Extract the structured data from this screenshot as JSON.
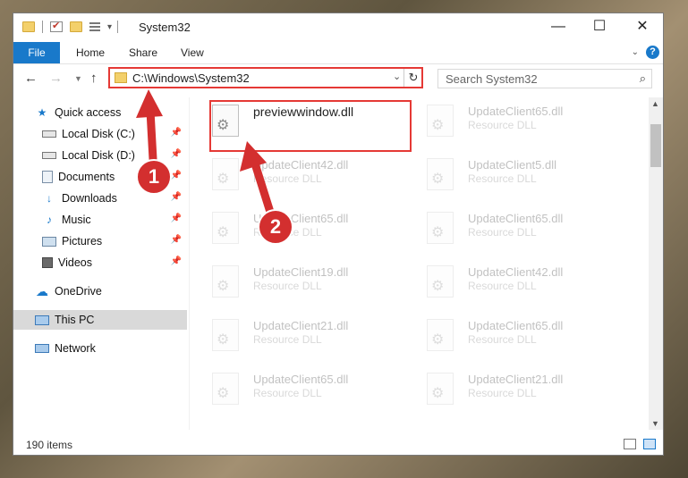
{
  "window": {
    "title": "System32",
    "minimize_glyph": "—",
    "maximize_glyph": "☐",
    "close_glyph": "✕"
  },
  "ribbon": {
    "tabs": [
      {
        "label": "File"
      },
      {
        "label": "Home"
      },
      {
        "label": "Share"
      },
      {
        "label": "View"
      }
    ],
    "help_glyph": "?"
  },
  "address": {
    "path": "C:\\Windows\\System32",
    "refresh_glyph": "↻"
  },
  "search": {
    "placeholder": "Search System32"
  },
  "nav": {
    "items": [
      {
        "label": "Quick access",
        "icon": "star-icon"
      },
      {
        "label": "Local Disk (C:)",
        "icon": "drive-icon",
        "pinned": true
      },
      {
        "label": "Local Disk (D:)",
        "icon": "drive-icon",
        "pinned": true
      },
      {
        "label": "Documents",
        "icon": "documents-icon",
        "pinned": true
      },
      {
        "label": "Downloads",
        "icon": "download-icon",
        "pinned": true
      },
      {
        "label": "Music",
        "icon": "music-icon",
        "pinned": true
      },
      {
        "label": "Pictures",
        "icon": "pictures-icon",
        "pinned": true
      },
      {
        "label": "Videos",
        "icon": "videos-icon",
        "pinned": true
      },
      {
        "label": "OneDrive",
        "icon": "cloud-icon"
      },
      {
        "label": "This PC",
        "icon": "computer-icon",
        "selected": true
      },
      {
        "label": "Network",
        "icon": "network-icon"
      }
    ]
  },
  "files": [
    {
      "name": "previewwindow.dll",
      "type": "",
      "highlighted": true
    },
    {
      "name": "UpdateClient65.dll",
      "type": "Resource DLL"
    },
    {
      "name": "UpdateClient42.dll",
      "type": "Resource DLL"
    },
    {
      "name": "UpdateClient5.dll",
      "type": "Resource DLL"
    },
    {
      "name": "UpdateClient65.dll",
      "type": "Resource DLL"
    },
    {
      "name": "UpdateClient65.dll",
      "type": "Resource DLL"
    },
    {
      "name": "UpdateClient19.dll",
      "type": "Resource DLL"
    },
    {
      "name": "UpdateClient42.dll",
      "type": "Resource DLL"
    },
    {
      "name": "UpdateClient21.dll",
      "type": "Resource DLL"
    },
    {
      "name": "UpdateClient65.dll",
      "type": "Resource DLL"
    },
    {
      "name": "UpdateClient65.dll",
      "type": "Resource DLL"
    },
    {
      "name": "UpdateClient21.dll",
      "type": "Resource DLL"
    }
  ],
  "status": {
    "count": "190 items"
  },
  "annotations": {
    "step1": "1",
    "step2": "2",
    "color": "#d32f2f"
  },
  "colors": {
    "accent": "#1979ca",
    "highlight_border": "#e53935"
  }
}
